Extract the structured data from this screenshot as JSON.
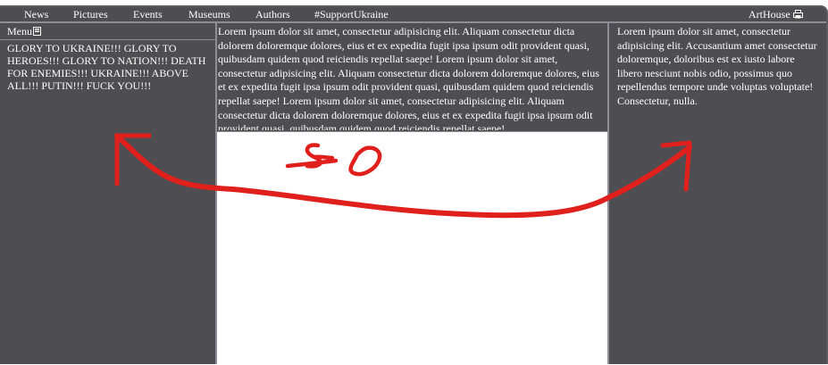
{
  "nav": {
    "items": [
      "News",
      "Pictures",
      "Events",
      "Museums",
      "Authors",
      "#SupportUkraine"
    ],
    "brand": "ArtHouse",
    "brand_icon": "printer-icon"
  },
  "left": {
    "menu_label": "Menu",
    "menu_icon": "menu-icon",
    "text": "GLORY TO UKRAINE!!! GLORY TO HEROES!!! GLORY TO NATION!!! DEATH FOR ENEMIES!!! UKRAINE!!! ABOVE ALL!!! PUTIN!!! FUCK YOU!!!"
  },
  "main": {
    "text": "Lorem ipsum dolor sit amet, consectetur adipisicing elit. Aliquam consectetur dicta dolorem doloremque dolores, eius et ex expedita fugit ipsa ipsum odit provident quasi, quibusdam quidem quod reiciendis repellat saepe! Lorem ipsum dolor sit amet, consectetur adipisicing elit. Aliquam consectetur dicta dolorem doloremque dolores, eius et ex expedita fugit ipsa ipsum odit provident quasi, quibusdam quidem quod reiciendis repellat saepe! Lorem ipsum dolor sit amet, consectetur adipisicing elit. Aliquam consectetur dicta dolorem doloremque dolores, eius et ex expedita fugit ipsa ipsum odit provident quasi, quibusdam quidem quod reiciendis repellat saepe!"
  },
  "right": {
    "text": "Lorem ipsum dolor sit amet, consectetur adipisicing elit. Accusantium amet consectetur doloremque, doloribus est ex iusto labore libero nesciunt nobis odio, possimus quo repellendus tempore unde voluptas voluptate! Consectetur, nulla."
  },
  "colors": {
    "background": "#4d4d52",
    "divider": "#8e8e94",
    "text": "#ffffff",
    "canvas": "#ffffff",
    "annotation": "#e0201c"
  }
}
